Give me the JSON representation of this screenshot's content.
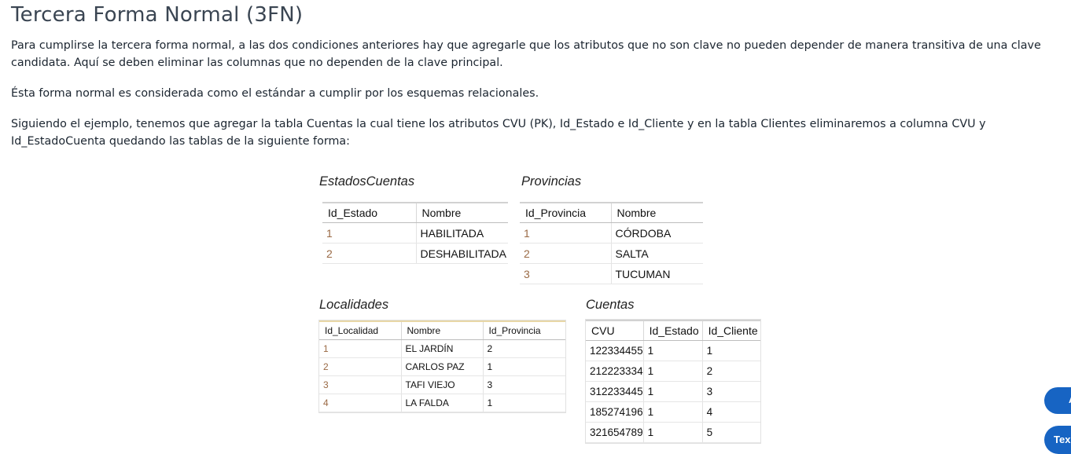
{
  "title": "Tercera Forma Normal (3FN)",
  "paragraphs": [
    "Para cumplirse la tercera forma normal, a las dos condiciones anteriores hay que agregarle que los atributos que no son clave no pueden depender de manera transitiva de una clave candidata. Aquí se deben eliminar las columnas que no dependen de la clave principal.",
    "Ésta forma normal es considerada como el estándar a cumplir por los esquemas relacionales.",
    "Siguiendo el ejemplo, tenemos que agregar la tabla Cuentas la cual tiene los atributos CVU (PK), Id_Estado e Id_Cliente y en la tabla Clientes eliminaremos a columna CVU y Id_EstadoCuenta quedando las tablas de la siguiente forma:"
  ],
  "tables": {
    "estados": {
      "caption": "EstadosCuentas",
      "headers": [
        "Id_Estado",
        "Nombre"
      ],
      "rows": [
        [
          "1",
          "HABILITADA"
        ],
        [
          "2",
          "DESHABILITADA"
        ]
      ]
    },
    "provincias": {
      "caption": "Provincias",
      "headers": [
        "Id_Provincia",
        "Nombre"
      ],
      "rows": [
        [
          "1",
          "CÓRDOBA"
        ],
        [
          "2",
          "SALTA"
        ],
        [
          "3",
          "TUCUMAN"
        ]
      ]
    },
    "localidades": {
      "caption": "Localidades",
      "headers": [
        "Id_Localidad",
        "Nombre",
        "Id_Provincia"
      ],
      "rows": [
        [
          "1",
          "EL JARDÍN",
          "2"
        ],
        [
          "2",
          "CARLOS PAZ",
          "1"
        ],
        [
          "3",
          "TAFI VIEJO",
          "3"
        ],
        [
          "4",
          "LA FALDA",
          "1"
        ]
      ]
    },
    "cuentas": {
      "caption": "Cuentas",
      "headers": [
        "CVU",
        "Id_Estado",
        "Id_Cliente"
      ],
      "rows": [
        [
          "122334455",
          "1",
          "1"
        ],
        [
          "212223334",
          "1",
          "2"
        ],
        [
          "312233445",
          "1",
          "3"
        ],
        [
          "185274196",
          "1",
          "4"
        ],
        [
          "321654789",
          "1",
          "5"
        ]
      ]
    }
  },
  "side_buttons": [
    "A",
    "Tex"
  ],
  "colors": {
    "button": "#1764c3",
    "id_text": "#9a6a45"
  }
}
